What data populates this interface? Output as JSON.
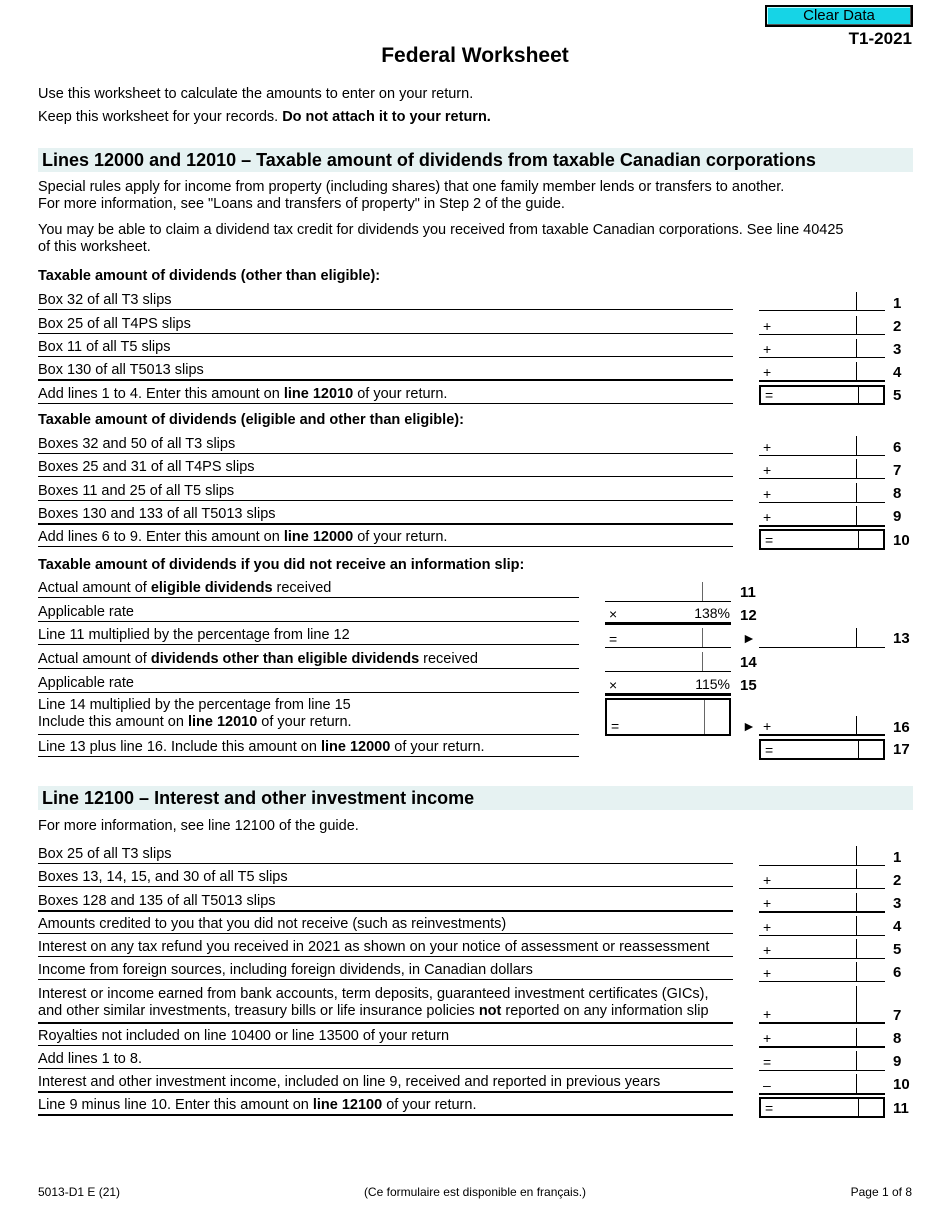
{
  "header": {
    "clear_button": "Clear Data",
    "form_id": "T1-2021",
    "title": "Federal Worksheet",
    "intro_1": "Use this worksheet to calculate the amounts to enter on your return.",
    "intro_2_pre": "Keep this worksheet for your records. ",
    "intro_2_bold": "Do not attach it to your return."
  },
  "section1": {
    "heading": "Lines 12000 and 12010 – Taxable amount of dividends from taxable Canadian corporations",
    "para_1a": "Special rules apply for income from property (including shares) that one family member lends or transfers to another.",
    "para_1b": "For more information, see \"Loans and transfers of property\" in Step 2 of the guide.",
    "para_2a": "You may be able to claim a dividend tax credit for dividends you received from taxable Canadian corporations. See line 40425",
    "para_2b": "of this worksheet.",
    "sub_a": "Taxable amount of dividends (other than eligible):",
    "sub_b": "Taxable amount of dividends (eligible and other than eligible):",
    "sub_c": "Taxable amount of dividends if you did not receive an information slip:",
    "lines_a": [
      {
        "label": "Box 32 of all T3 slips",
        "op": "",
        "num": "1"
      },
      {
        "label": "Box 25 of all T4PS slips",
        "op": "+",
        "num": "2"
      },
      {
        "label": "Box 11 of all T5 slips",
        "op": "+",
        "num": "3"
      },
      {
        "label": "Box 130 of all T5013 slips",
        "op": "+",
        "num": "4"
      },
      {
        "pre": "Add lines 1 to 4. Enter this amount on ",
        "bold": "line 12010",
        "post": " of your return.",
        "op": "=",
        "num": "5"
      }
    ],
    "lines_b": [
      {
        "label": "Boxes 32 and 50 of all T3 slips",
        "op": "+",
        "num": "6"
      },
      {
        "label": "Boxes 25 and 31 of all T4PS slips",
        "op": "+",
        "num": "7"
      },
      {
        "label": "Boxes 11 and 25 of all T5 slips",
        "op": "+",
        "num": "8"
      },
      {
        "label": "Boxes 130 and 133 of all T5013 slips",
        "op": "+",
        "num": "9"
      },
      {
        "pre": "Add lines 6 to 9. Enter this amount on ",
        "bold": "line 12000",
        "post": " of your return.",
        "op": "=",
        "num": "10"
      }
    ],
    "lines_c": {
      "l11": {
        "pre": "Actual amount of ",
        "bold": "eligible dividends",
        "post": " received",
        "num": "11"
      },
      "l12": {
        "label": "Applicable rate",
        "op": "×",
        "rate": "138%",
        "num": "12"
      },
      "l13": {
        "label": "Line 11 multiplied by the percentage from line 12",
        "op": "=",
        "arrow": "►",
        "num": "13"
      },
      "l14": {
        "pre": "Actual amount of ",
        "bold": "dividends other than eligible dividends",
        "post": " received",
        "num": "14"
      },
      "l15": {
        "label": "Applicable rate",
        "op": "×",
        "rate": "115%",
        "num": "15"
      },
      "l16": {
        "label_1": "Line 14 multiplied by the percentage from line 15",
        "label_2_pre": "Include this amount on ",
        "label_2_bold": "line 12010",
        "label_2_post": " of your return.",
        "op": "=",
        "arrow": "►",
        "op_right": "+",
        "num": "16"
      },
      "l17": {
        "pre": "Line 13 plus line 16. Include this amount on ",
        "bold": "line 12000",
        "post": " of your return.",
        "op": "=",
        "num": "17"
      }
    }
  },
  "section2": {
    "heading": "Line 12100 – Interest and other investment income",
    "intro": "For more information, see line 12100 of the guide.",
    "lines": [
      {
        "label": "Box 25 of all T3 slips",
        "op": "",
        "num": "1"
      },
      {
        "label": "Boxes 13, 14, 15, and 30 of all T5 slips",
        "op": "+",
        "num": "2"
      },
      {
        "label": "Boxes 128 and 135 of all T5013 slips",
        "op": "+",
        "num": "3"
      },
      {
        "label": "Amounts credited to you that you did not receive (such as reinvestments)",
        "op": "+",
        "num": "4"
      },
      {
        "label": "Interest on any tax refund you received in 2021 as shown on your notice of assessment or reassessment",
        "op": "+",
        "num": "5"
      },
      {
        "label": "Income from foreign sources, including foreign dividends, in Canadian dollars",
        "op": "+",
        "num": "6"
      },
      {
        "label_1": "Interest or income earned from bank accounts, term deposits, guaranteed investment certificates (GICs),",
        "label_2_pre": "and other similar investments, treasury bills or life insurance policies ",
        "label_2_bold": "not",
        "label_2_post": " reported on any information slip",
        "op": "+",
        "num": "7"
      },
      {
        "label": "Royalties not included on line 10400 or line 13500 of your return",
        "op": "+",
        "num": "8"
      },
      {
        "label": "Add lines 1 to 8.",
        "op": "=",
        "num": "9"
      },
      {
        "label": "Interest and other investment income, included on line 9, received and reported in previous years",
        "op": "–",
        "num": "10"
      },
      {
        "pre": "Line 9 minus line 10. Enter this amount on ",
        "bold": "line 12100",
        "post": " of your return.",
        "op": "=",
        "num": "11"
      }
    ]
  },
  "footer": {
    "form_code": "5013-D1 E (21)",
    "french_note": "(Ce formulaire est disponible en français.)",
    "page": "Page 1 of 8"
  }
}
